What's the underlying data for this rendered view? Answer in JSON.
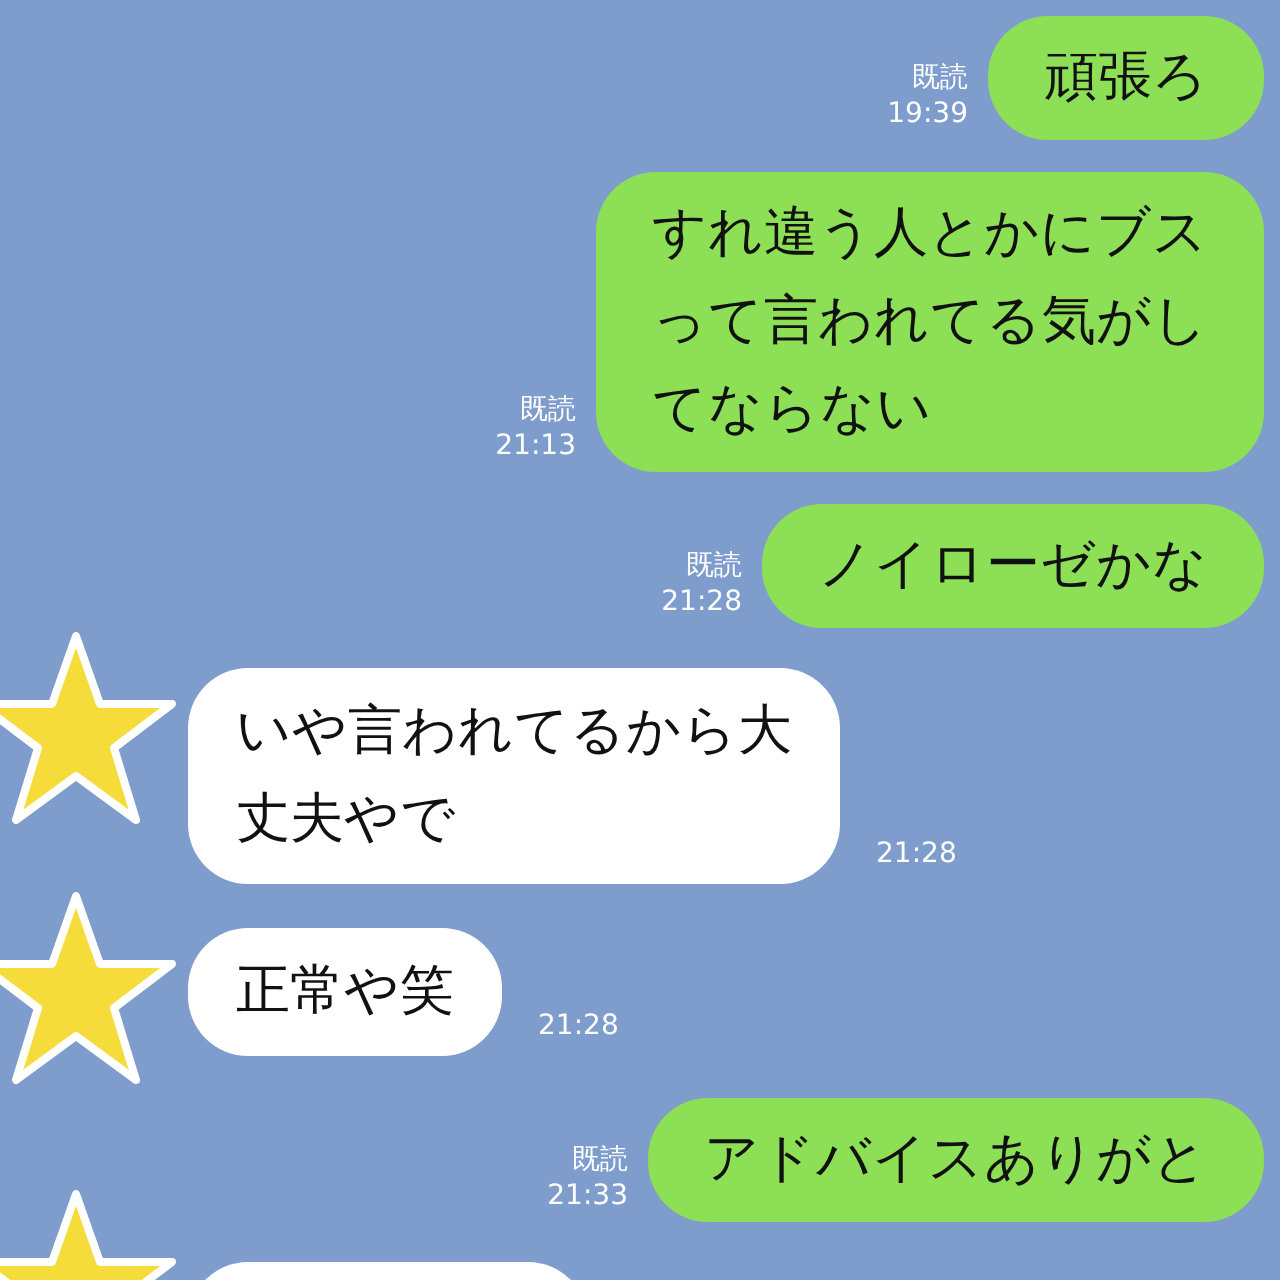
{
  "messages": [
    {
      "kind": "message",
      "outgoing": true,
      "read": "既読",
      "time": "19:39",
      "lines": [
        "頑張ろ"
      ]
    },
    {
      "kind": "message",
      "outgoing": true,
      "read": "既読",
      "time": "21:13",
      "lines": [
        "すれ違う人とかにブス",
        "って言われてる気がし",
        "てならない"
      ]
    },
    {
      "kind": "message",
      "outgoing": true,
      "read": "既読",
      "time": "21:28",
      "lines": [
        "ノイローゼかな"
      ]
    },
    {
      "kind": "message",
      "outgoing": false,
      "time": "21:28",
      "lines": [
        "いや言われてるから大",
        "丈夫やで"
      ]
    },
    {
      "kind": "message",
      "outgoing": false,
      "time": "21:28",
      "lines": [
        "正常や笑"
      ]
    },
    {
      "kind": "message",
      "outgoing": true,
      "read": "既読",
      "time": "21:33",
      "lines": [
        "アドバイスありがと"
      ]
    },
    {
      "kind": "cut_off",
      "outgoing": false
    }
  ]
}
